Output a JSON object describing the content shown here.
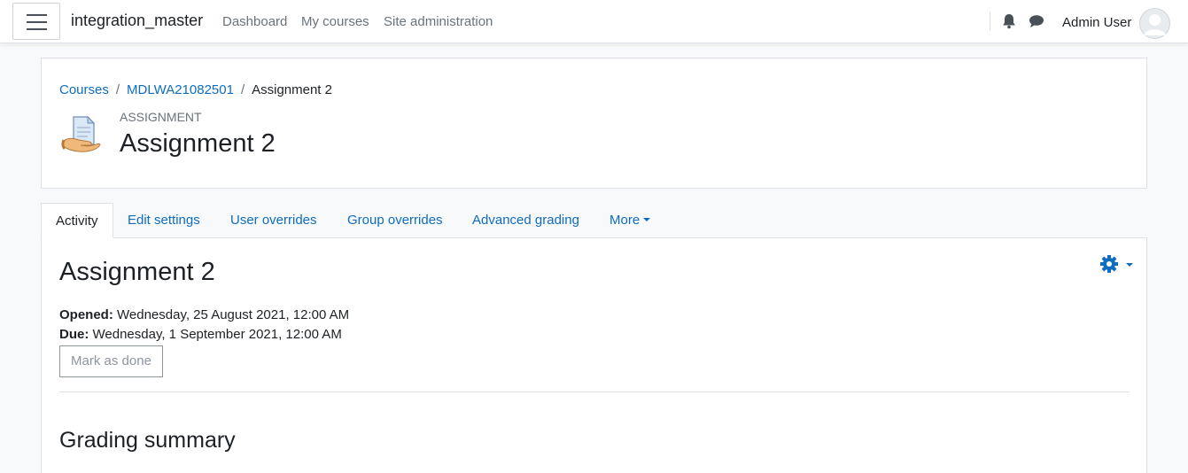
{
  "navbar": {
    "site_name": "integration_master",
    "links": [
      "Dashboard",
      "My courses",
      "Site administration"
    ],
    "user_name": "Admin User",
    "icons": [
      "menu-icon",
      "bell-icon",
      "chat-icon",
      "avatar-icon"
    ]
  },
  "header": {
    "breadcrumb": [
      "Courses",
      "MDLWA21082501",
      "Assignment 2"
    ],
    "activity_type": "ASSIGNMENT",
    "title": "Assignment 2"
  },
  "tabs": [
    {
      "label": "Activity",
      "active": true
    },
    {
      "label": "Edit settings"
    },
    {
      "label": "User overrides"
    },
    {
      "label": "Group overrides"
    },
    {
      "label": "Advanced grading"
    },
    {
      "label": "More"
    }
  ],
  "main": {
    "title": "Assignment 2",
    "opened_label": "Opened:",
    "opened_value": "Wednesday, 25 August 2021, 12:00 AM",
    "due_label": "Due:",
    "due_value": "Wednesday, 1 September 2021, 12:00 AM",
    "mark_done": "Mark as done",
    "section_title": "Grading summary"
  },
  "colors": {
    "link": "#0f6cbf",
    "text": "#1d2125",
    "muted": "#6a737b",
    "background": "#f8f9fa"
  }
}
